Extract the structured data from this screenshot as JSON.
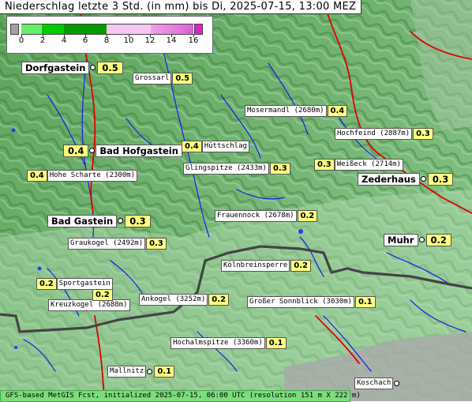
{
  "title": "Niederschlag letzte 3 Std. (in mm) bis Di, 2025-07-15, 13:00 MEZ",
  "legend": {
    "ticks": [
      "0",
      "2",
      "4",
      "6",
      "8",
      "10",
      "12",
      "14",
      "16"
    ],
    "colors": {
      "below_zero": "#a0a0a0",
      "light_green": "#66ee66",
      "green": "#00cc00",
      "dark_green": "#009900",
      "pink_light": "#f4c8f0",
      "pink": "#e880e0",
      "magenta": "#e020c8"
    }
  },
  "places": [
    {
      "name": "Dorfgastein",
      "value": "0.5",
      "style": "big"
    },
    {
      "name": "Grossarl",
      "value": "0.5",
      "style": "small"
    },
    {
      "name": "Mosermandl (2680m)",
      "value": "0.4",
      "style": "small"
    },
    {
      "name": "Hochfeind (2887m)",
      "value": "0.3",
      "style": "small"
    },
    {
      "name": "Bad Hofgastein",
      "value": "0.4",
      "style": "big"
    },
    {
      "name": "Hüttschlag",
      "value": "0.4",
      "style": "small"
    },
    {
      "name": "Glingspitze (2433m)",
      "value": "0.3",
      "style": "small"
    },
    {
      "name": "Weißeck (2714m)",
      "value": "0.3",
      "style": "small"
    },
    {
      "name": "Hohe Scharte (2300m)",
      "value": "0.4",
      "style": "small"
    },
    {
      "name": "Zederhaus",
      "value": "0.3",
      "style": "big"
    },
    {
      "name": "Frauennock (2678m)",
      "value": "0.2",
      "style": "small"
    },
    {
      "name": "Bad Gastein",
      "value": "0.3",
      "style": "big"
    },
    {
      "name": "Muhr",
      "value": "0.2",
      "style": "big"
    },
    {
      "name": "Graukogel (2492m)",
      "value": "0.3",
      "style": "small"
    },
    {
      "name": "Kölnbreinsperre",
      "value": "0.2",
      "style": "small"
    },
    {
      "name": "Sportgastein",
      "value": "0.2",
      "style": "small"
    },
    {
      "name": "Kreuzkogel (2688m)",
      "value": "0.2",
      "style": "small"
    },
    {
      "name": "Ankogel (3252m)",
      "value": "0.2",
      "style": "small"
    },
    {
      "name": "Großer Sonnblick (3030m)",
      "value": "0.1",
      "style": "small"
    },
    {
      "name": "Hochalmspitze (3360m)",
      "value": "0.1",
      "style": "small"
    },
    {
      "name": "Mallnitz",
      "value": "0.1",
      "style": "small"
    },
    {
      "name": "Koschach",
      "value": "",
      "style": "small"
    }
  ],
  "footer": "GFS-based MetGIS Fcst, initialized 2025-07-15, 06:00 UTC  (resolution 151 m X 222 m)"
}
